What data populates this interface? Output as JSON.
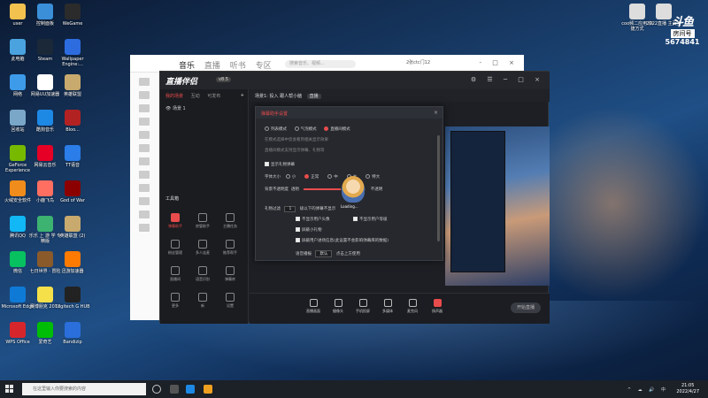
{
  "desktop": {
    "icons_left": [
      {
        "label": "user",
        "color": "#f2c14e"
      },
      {
        "label": "控制面板",
        "color": "#3a8fd8"
      },
      {
        "label": "WeGame",
        "color": "#2b2b2b"
      },
      {
        "label": "此电脑",
        "color": "#4aa3df"
      },
      {
        "label": "Steam",
        "color": "#1b2838"
      },
      {
        "label": "Wallpaper Engine:...",
        "color": "#2d6cdf"
      },
      {
        "label": "网络",
        "color": "#3d9be9"
      },
      {
        "label": "网易UU加速器",
        "color": "#ffffff"
      },
      {
        "label": "英雄联盟",
        "color": "#c8aa6e"
      },
      {
        "label": "回收站",
        "color": "#7aa7c7"
      },
      {
        "label": "酷狗音乐",
        "color": "#1e88e5"
      },
      {
        "label": "Bloo...",
        "color": "#b22222"
      },
      {
        "label": "GeForce Experience",
        "color": "#76b900"
      },
      {
        "label": "网易云音乐",
        "color": "#e60026"
      },
      {
        "label": "TT语音",
        "color": "#2b7de9"
      },
      {
        "label": "火绒安全软件",
        "color": "#f08c1b"
      },
      {
        "label": "小鹿飞鸟",
        "color": "#ff6f61"
      },
      {
        "label": "God of War",
        "color": "#8b0000"
      },
      {
        "label": "腾讯QQ",
        "color": "#12b7f5"
      },
      {
        "label": "乐乐 上 游 学 专精版",
        "color": "#3cb371"
      },
      {
        "label": "英雄联盟 (2)",
        "color": "#c8aa6e"
      },
      {
        "label": "微信",
        "color": "#07c160"
      },
      {
        "label": "七日世界 · 冒险",
        "color": "#8a5a2b"
      },
      {
        "label": "迅游加速器",
        "color": "#ff7a00"
      },
      {
        "label": "Microsoft Edge",
        "color": "#0f7ad6"
      },
      {
        "label": "赛博朋克 2077",
        "color": "#f5e04a"
      },
      {
        "label": "Logitech G HUB",
        "color": "#222222"
      },
      {
        "label": "WPS Office",
        "color": "#d6262c"
      },
      {
        "label": "爱奇艺",
        "color": "#00be06"
      },
      {
        "label": "Bandizip",
        "color": "#2a6fdb"
      }
    ],
    "icons_right": [
      {
        "label": "coo频二应用 快捷方式",
        "color": "#dddddd"
      },
      {
        "label": "2022直播 主页签",
        "color": "#dddddd"
      }
    ]
  },
  "watermark": {
    "logo": "斗鱼",
    "room_label": "房间号",
    "room_number": "5674841"
  },
  "music_window": {
    "tabs": [
      "音乐",
      "直播",
      "听书",
      "专区"
    ],
    "search_placeholder": "搜索音乐、视频...",
    "user": "2张ctc门12",
    "controls": "- □ ×"
  },
  "app": {
    "brand": "直播伴侣",
    "version": "v8.5",
    "header_icons": "⚙ ☰ ─ □ ×",
    "left_tabs": [
      "我的场景",
      "互动",
      "可发布"
    ],
    "add": "+",
    "scene_name": "场景 1",
    "tools_title": "工具箱",
    "tools": [
      {
        "label": "弹幕助手",
        "active": true
      },
      {
        "label": "房管助手",
        "active": false
      },
      {
        "label": "主播任务",
        "active": false
      },
      {
        "label": "粉丝管理",
        "active": false
      },
      {
        "label": "多人连麦",
        "active": false
      },
      {
        "label": "推荐帮手",
        "active": false
      },
      {
        "label": "直播间",
        "active": false
      },
      {
        "label": "语音识别",
        "active": false
      },
      {
        "label": "弹幕库",
        "active": false
      },
      {
        "label": "更多",
        "active": false
      },
      {
        "label": "新",
        "active": false
      },
      {
        "label": "设置",
        "active": false
      }
    ],
    "main_header": {
      "scene": "场景1: 投入",
      "title": "跟人帮小脑",
      "tag": "直播"
    },
    "bottom_bar": [
      {
        "label": "直播画面",
        "live": false
      },
      {
        "label": "摄像头",
        "live": false
      },
      {
        "label": "手机投屏",
        "live": false
      },
      {
        "label": "多媒体",
        "live": false
      },
      {
        "label": "麦克风",
        "live": false
      },
      {
        "label": "扬声器",
        "live": true
      }
    ],
    "start_button": "开始直播"
  },
  "dialog": {
    "title": "弹幕助手设置",
    "close": "×",
    "mode_options": [
      {
        "label": "列表模式",
        "on": false
      },
      {
        "label": "气泡模式",
        "on": false
      },
      {
        "label": "直播间模式",
        "on": true
      }
    ],
    "desc1": "在模式选择中您会看到相关显示效果",
    "desc2": "直播间模式支持显示弹幕、礼物等",
    "show_barrage": "显示礼物弹幕",
    "font_size_label": "字体大小",
    "font_sizes": [
      {
        "label": "小",
        "on": false
      },
      {
        "label": "正常",
        "on": true
      },
      {
        "label": "中",
        "on": false
      },
      {
        "label": "大",
        "on": false
      },
      {
        "label": "特大",
        "on": false
      }
    ],
    "opacity_label": "背景不透明度",
    "opacity_min": "透明",
    "opacity_max": "不透明",
    "opacity_value": 0.6,
    "filter_label": "礼物过滤",
    "filter_value": "1",
    "filter_unit": "级以下的弹幕不显示",
    "opt1": "不显示用户头像",
    "opt2": "不显示用户等级",
    "opt3": "屏蔽小礼物",
    "opt4": "屏蔽用户进场信息(此设置不会影响弹幕库的数据)",
    "tts_label": "语音播报",
    "tts_value": "默认",
    "tts_note": "点击上方使用",
    "mascot_label": "Loading..."
  },
  "taskbar": {
    "search_placeholder": "在这里输入你要搜索的内容",
    "tray": "^ ☁ 🔊 中",
    "time": "21:05",
    "date": "2022/4/27"
  }
}
